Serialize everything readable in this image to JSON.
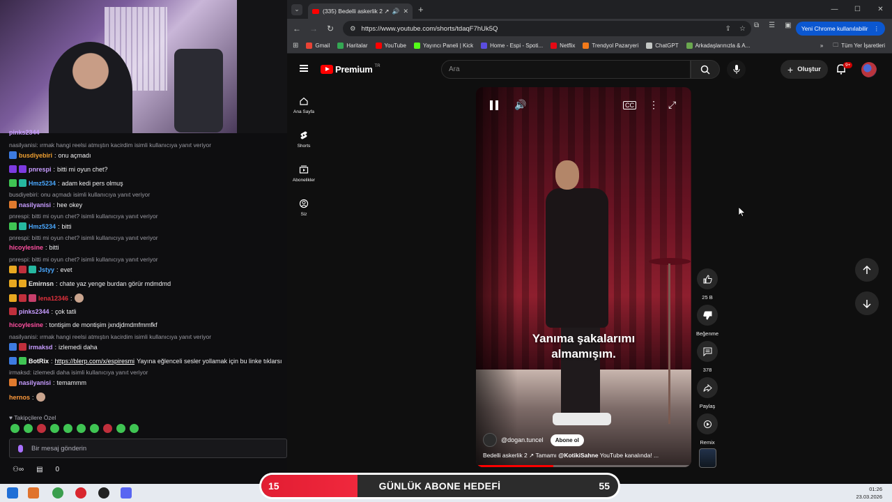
{
  "chat": {
    "messages": [
      {
        "type": "reply",
        "text": "nasilyanisi: ırmak hangi reelsi atmıştın kacirdim isimli kullanıcıya yanıt veriyor"
      },
      {
        "type": "msg",
        "user": "busdiyebiri",
        "user_color": "#f0a030",
        "text": "onu açmadı"
      },
      {
        "type": "msg",
        "user": "pnrespi",
        "user_color": "#c79cff",
        "text": "bitti mi oyun chet?"
      },
      {
        "type": "msg",
        "user": "Hmz5234",
        "user_color": "#4aa8ff",
        "text": "adam kedi pers olmuş"
      },
      {
        "type": "reply",
        "text": "busdiyebiri: onu açmadı isimli kullanıcıya yanıt veriyor"
      },
      {
        "type": "msg",
        "user": "nasilyanisi",
        "user_color": "#c79cff",
        "text": "hee okey"
      },
      {
        "type": "reply",
        "text": "pnrespi: bitti mi oyun chet? isimli kullanıcıya yanıt veriyor"
      },
      {
        "type": "msg",
        "user": "Hmz5234",
        "user_color": "#4aa8ff",
        "text": "bitti"
      },
      {
        "type": "reply",
        "text": "pnrespi: bitti mi oyun chet? isimli kullanıcıya yanıt veriyor"
      },
      {
        "type": "msg",
        "user": "hicoylesine",
        "user_color": "#ff4fa0",
        "text": "bitti"
      },
      {
        "type": "reply",
        "text": "pnrespi: bitti mi oyun chet? isimli kullanıcıya yanıt veriyor"
      },
      {
        "type": "msg",
        "user": "Jstyy",
        "user_color": "#4aa8ff",
        "text": "evet"
      },
      {
        "type": "msg",
        "user": "Emirnsn",
        "user_color": "#e8e8e8",
        "text": "chate yaz yenge burdan görür mdmdmd"
      },
      {
        "type": "msg",
        "user": "lena12346",
        "user_color": "#e0303c",
        "text": ""
      },
      {
        "type": "msg",
        "user": "pinks2344",
        "user_color": "#c79cff",
        "text": "çok tatli"
      },
      {
        "type": "msg",
        "user": "hicoylesine",
        "user_color": "#ff4fa0",
        "text": "tontişim de montişim jxndjdmdmfmmfkf"
      },
      {
        "type": "reply",
        "text": "nasilyanisi: ırmak hangi reelsi atmıştın kacirdim isimli kullanıcıya yanıt veriyor"
      },
      {
        "type": "msg",
        "user": "irmaksd",
        "user_color": "#c79cff",
        "text": "izlemedi daha"
      },
      {
        "type": "msg",
        "user": "BotRix",
        "user_color": "#ffffff",
        "text": "Yayına eğlenceli sesler yollamak için bu linke tıklarsı",
        "link": "https://blerp.com/x/espiresmi"
      },
      {
        "type": "reply",
        "text": "irmaksd: izlemedi daha isimli kullanıcıya yanıt veriyor"
      },
      {
        "type": "msg",
        "user": "nasilyanisi",
        "user_color": "#c79cff",
        "text": "temammm"
      },
      {
        "type": "msg",
        "user": "hernos",
        "user_color": "#ff9a3c",
        "text": ""
      }
    ],
    "top_partial_user": "pinks2344",
    "followers_label": "Takipçilere Özel",
    "input_placeholder": "Bir mesaj gönderin",
    "bottom_count": "0"
  },
  "browser": {
    "tab_title": "(335) Bedelli askerlik 2 ↗",
    "url": "https://www.youtube.com/shorts/tdaqF7hUk5Q",
    "update_label": "Yeni Chrome kullanılabilir",
    "bookmarks": [
      {
        "label": "Gmail",
        "color": "#ea4335"
      },
      {
        "label": "Haritalar",
        "color": "#34a853"
      },
      {
        "label": "YouTube",
        "color": "#ff0000"
      },
      {
        "label": "Yayıncı Paneli | Kick",
        "color": "#53fc18"
      },
      {
        "label": "Home - Espi - Spoti...",
        "color": "#5b4de0"
      },
      {
        "label": "Netflix",
        "color": "#e50914"
      },
      {
        "label": "Trendyol Pazaryeri",
        "color": "#f27a1a"
      },
      {
        "label": "ChatGPT",
        "color": "#c4c7c5"
      },
      {
        "label": "Arkadaşlarınızla & A...",
        "color": "#6aa84f"
      }
    ],
    "all_bookmarks": "Tüm Yer İşaretleri"
  },
  "youtube": {
    "logo": "Premium",
    "logo_region": "TR",
    "search_placeholder": "Ara",
    "create_label": "Oluştur",
    "notif_count": "9+",
    "guide": [
      {
        "label": "Ana Sayfa",
        "icon": "home-icon"
      },
      {
        "label": "Shorts",
        "icon": "shorts-icon"
      },
      {
        "label": "Abonelikler",
        "icon": "subscriptions-icon"
      },
      {
        "label": "Siz",
        "icon": "you-icon"
      }
    ],
    "video": {
      "caption_line1": "Yanıma şakalarımı",
      "caption_line2": "almamışım.",
      "channel": "@dogan.tuncel",
      "subscribe": "Abone ol",
      "desc_prefix": "Bedelli askerlik 2 ↗ Tamamı ",
      "desc_mention": "@KotikiSahne",
      "desc_suffix": " YouTube kanalında! ...",
      "progress": 0.36
    },
    "actions": {
      "likes": "25 B",
      "dislike": "Beğenme",
      "comments": "378",
      "share": "Paylaş",
      "remix": "Remix"
    }
  },
  "goal": {
    "current": "15",
    "title": "GÜNLÜK ABONE HEDEFİ",
    "target": "55",
    "progress": 0.27
  },
  "clock": {
    "time": "01:26",
    "date": "23.03.2026"
  }
}
